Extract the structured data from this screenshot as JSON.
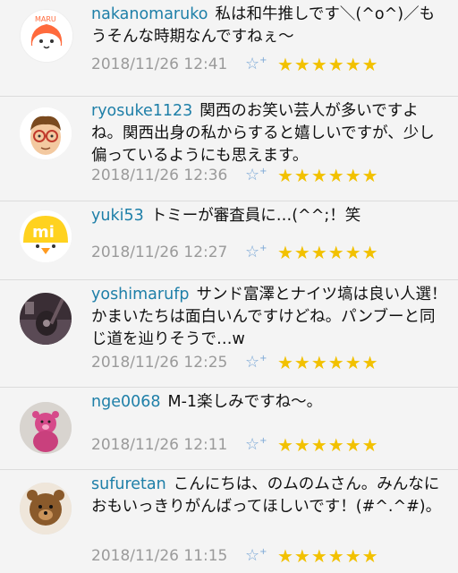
{
  "comments": [
    {
      "user": "nakanomaruko",
      "text": "私は和牛推しです＼(^o^)／もうそんな時期なんですねぇ〜",
      "date": "2018/11/26 12:41",
      "avatar": "maru-character-avatar",
      "rating": "★★★★★★"
    },
    {
      "user": "ryosuke1123",
      "text": "関西のお笑い芸人が多いですよね。関西出身の私からすると嬉しいですが、少し偏っているようにも思えます。",
      "date": "2018/11/26 12:36",
      "avatar": "glasses-man-avatar",
      "rating": "★★★★★★"
    },
    {
      "user": "yuki53",
      "text": "トミーが審査員に…(^^;！笑",
      "date": "2018/11/26 12:27",
      "avatar": "mi-chick-avatar",
      "rating": "★★★★★★"
    },
    {
      "user": "yoshimarufp",
      "text": "サンド富澤とナイツ塙は良い人選！かまいたちは面白いんですけどね。パンブーと同じ道を辿りそうで…w",
      "date": "2018/11/26 12:25",
      "avatar": "guitar-photo-avatar",
      "rating": "★★★★★★"
    },
    {
      "user": "nge0068",
      "text": "M-1楽しみですね〜。",
      "date": "2018/11/26 12:11",
      "avatar": "pink-bear-toy-avatar",
      "rating": "★★★★★★"
    },
    {
      "user": "sufuretan",
      "text": "こんにちは、のムのムさん。みんなにおもいっきりがんばってほしいです！(#^.^#)。",
      "date": "2018/11/26 11:15",
      "avatar": "teddy-bear-avatar",
      "rating": "★★★★★★"
    }
  ],
  "star_add_icon": "☆",
  "star_add_plus": "+",
  "colors": {
    "username": "#1e7fa8",
    "date": "#9a9a9a",
    "star": "#f2c100",
    "star_add": "#7aa7d6",
    "background": "#f4f4f4"
  }
}
